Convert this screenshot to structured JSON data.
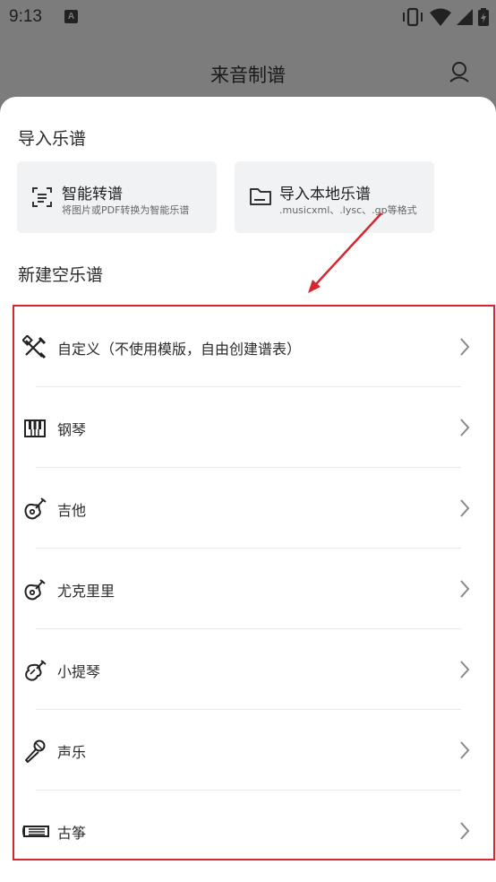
{
  "status": {
    "time": "9:13",
    "notif_letter": "A"
  },
  "header": {
    "title": "来音制谱"
  },
  "import_section": {
    "title": "导入乐谱",
    "cards": [
      {
        "title": "智能转谱",
        "subtitle": "将图片或PDF转换为智能乐谱",
        "icon": "scan-icon"
      },
      {
        "title": "导入本地乐谱",
        "subtitle": ".musicxml、.lysc、.gp等格式",
        "icon": "folder-icon"
      }
    ]
  },
  "new_section": {
    "title": "新建空乐谱",
    "items": [
      {
        "label": "自定义（不使用模版，自由创建谱表）",
        "icon": "custom-tools-icon"
      },
      {
        "label": "钢琴",
        "icon": "piano-icon"
      },
      {
        "label": "吉他",
        "icon": "guitar-icon"
      },
      {
        "label": "尤克里里",
        "icon": "ukulele-icon"
      },
      {
        "label": "小提琴",
        "icon": "violin-icon"
      },
      {
        "label": "声乐",
        "icon": "microphone-icon"
      },
      {
        "label": "古筝",
        "icon": "guzheng-icon"
      }
    ]
  },
  "colors": {
    "highlight": "#d6262f",
    "overlay": "#7c7c7c",
    "card_bg": "#f1f2f4"
  }
}
